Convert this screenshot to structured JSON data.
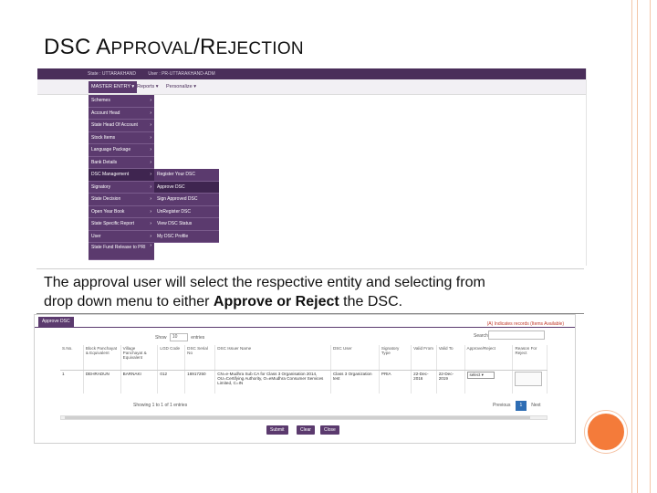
{
  "slide": {
    "title_first": "DSC A",
    "title_small1": "PPROVAL",
    "title_slash": "/R",
    "title_small2": "EJECTION",
    "caption_line1": "The approval user will select the respective entity and selecting from",
    "caption_line2_pre": "drop down menu to either ",
    "caption_bold": "Approve or Reject",
    "caption_line2_post": " the DSC."
  },
  "app": {
    "state_label": "State : UTTARAKHAND",
    "user_label": "User : PR-UTTARAKHAND-ADM",
    "menu": {
      "master_entry": "MASTER ENTRY",
      "reports": "Reports",
      "personalize": "Personalize"
    },
    "master_items": [
      "Schemes",
      "Account Head",
      "State Head Of Account",
      "Stock Items",
      "Language Package",
      "Bank Details",
      "DSC Management",
      "Signatory",
      "State Decision",
      "Open Year Book",
      "State Specific Report",
      "User",
      "State Fund Release to PRI"
    ],
    "dsc_items": [
      "Register Your DSC",
      "Approve DSC",
      "Sign Approved DSC",
      "UnRegister DSC",
      "View DSC Status",
      "My DSC Profile"
    ]
  },
  "approve": {
    "tab_label": "Approve DSC",
    "links": "(A) Indicates records  (Items Available)",
    "show_label": "Show",
    "show_value": "10",
    "entries_label": "entries",
    "search_label": "Search:",
    "columns": [
      "S.No.",
      "Block Panchayat & Equivalent",
      "Village Panchayat & Equivalent",
      "LGD Code",
      "DSC Serial No",
      "DSC Issuer Name",
      "DSC User",
      "Signatory Type",
      "Valid From",
      "Valid To",
      "Approve/Reject",
      "Reason For Reject"
    ],
    "rows": [
      {
        "sno": "1",
        "block": "DEHRADUN",
        "village": "BARNAKI",
        "lgd": "012",
        "serial": "16917250",
        "issuer": "CN=e-Mudhra Sub CA for Class 3 Organisation 2014, OU=Certifying Authority, O=eMudhra Consumer Services Limited, C=IN",
        "user": "Class 3 Organization test",
        "type": "PRIA",
        "from": "22-Dec-2016",
        "to": "22-Dec-2019",
        "action": "select"
      }
    ],
    "showing": "Showing 1 to 1 of 1 entries",
    "previous": "Previous",
    "page": "1",
    "next": "Next",
    "submit": "Submit",
    "clear": "Clear",
    "close": "Close"
  },
  "colors": {
    "brand_purple": "#5b3a6e",
    "accent_orange": "#f47b3a",
    "pager_blue": "#2e6db4"
  }
}
